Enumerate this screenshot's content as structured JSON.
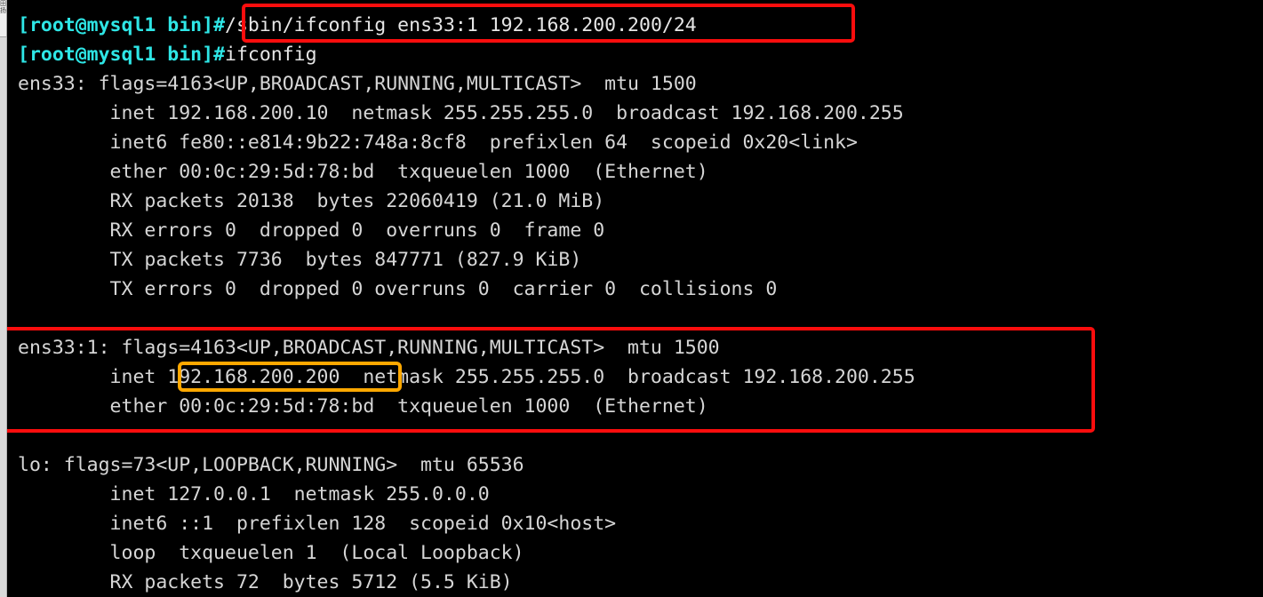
{
  "window": {
    "background_color": "#000000",
    "foreground_color": "#d8d8d8",
    "prompt_color": "#2ee6e6",
    "annotation_red": "#fb0d0d",
    "annotation_orange": "#ffa800"
  },
  "sidebar": {
    "tab_glyph_top": "田",
    "tab_glyph_bottom": "扬",
    "tooltip": ""
  },
  "terminal": {
    "prompt_text": "[root@mysql1 bin]",
    "hash": "#",
    "lines": [
      {
        "type": "command",
        "prompt": "[root@mysql1 bin]",
        "hash": "#",
        "command": "/sbin/ifconfig ens33:1 192.168.200.200/24"
      },
      {
        "type": "command",
        "prompt": "[root@mysql1 bin]",
        "hash": "#",
        "command": "ifconfig"
      },
      {
        "type": "output",
        "text": "ens33: flags=4163<UP,BROADCAST,RUNNING,MULTICAST>  mtu 1500"
      },
      {
        "type": "output",
        "text": "        inet 192.168.200.10  netmask 255.255.255.0  broadcast 192.168.200.255"
      },
      {
        "type": "output",
        "text": "        inet6 fe80::e814:9b22:748a:8cf8  prefixlen 64  scopeid 0x20<link>"
      },
      {
        "type": "output",
        "text": "        ether 00:0c:29:5d:78:bd  txqueuelen 1000  (Ethernet)"
      },
      {
        "type": "output",
        "text": "        RX packets 20138  bytes 22060419 (21.0 MiB)"
      },
      {
        "type": "output",
        "text": "        RX errors 0  dropped 0  overruns 0  frame 0"
      },
      {
        "type": "output",
        "text": "        TX packets 7736  bytes 847771 (827.9 KiB)"
      },
      {
        "type": "output",
        "text": "        TX errors 0  dropped 0 overruns 0  carrier 0  collisions 0"
      },
      {
        "type": "blank",
        "text": ""
      },
      {
        "type": "output",
        "text": "ens33:1: flags=4163<UP,BROADCAST,RUNNING,MULTICAST>  mtu 1500"
      },
      {
        "type": "output",
        "text": "        inet 192.168.200.200  netmask 255.255.255.0  broadcast 192.168.200.255"
      },
      {
        "type": "output",
        "text": "        ether 00:0c:29:5d:78:bd  txqueuelen 1000  (Ethernet)"
      },
      {
        "type": "blank",
        "text": ""
      },
      {
        "type": "output",
        "text": "lo: flags=73<UP,LOOPBACK,RUNNING>  mtu 65536"
      },
      {
        "type": "output",
        "text": "        inet 127.0.0.1  netmask 255.0.0.0"
      },
      {
        "type": "output",
        "text": "        inet6 ::1  prefixlen 128  scopeid 0x10<host>"
      },
      {
        "type": "output",
        "text": "        loop  txqueuelen 1  (Local Loopback)"
      },
      {
        "type": "output",
        "text": "        RX packets 72  bytes 5712 (5.5 KiB)"
      }
    ]
  },
  "annotations": {
    "command_box": {
      "label": "ifconfig alias command highlight",
      "color": "#fb0d0d",
      "target_text": "#/sbin/ifconfig ens33:1 192.168.200.200/24"
    },
    "interface_box": {
      "label": "ens33:1 virtual interface block highlight",
      "color": "#fb0d0d",
      "target_text": "ens33:1: flags=4163<UP,BROADCAST,RUNNING,MULTICAST>  mtu 1500"
    },
    "ip_box": {
      "label": "alias IP address highlight",
      "color": "#ffa800",
      "target_text": "192.168.200.200"
    }
  }
}
